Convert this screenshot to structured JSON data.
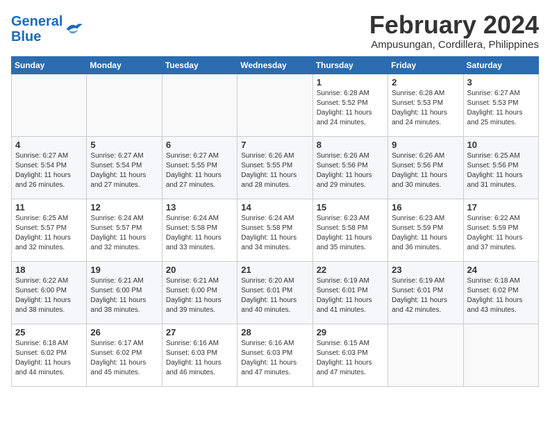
{
  "header": {
    "logo_general": "General",
    "logo_blue": "Blue",
    "month_year": "February 2024",
    "location": "Ampusungan, Cordillera, Philippines"
  },
  "weekdays": [
    "Sunday",
    "Monday",
    "Tuesday",
    "Wednesday",
    "Thursday",
    "Friday",
    "Saturday"
  ],
  "weeks": [
    [
      {
        "day": "",
        "info": ""
      },
      {
        "day": "",
        "info": ""
      },
      {
        "day": "",
        "info": ""
      },
      {
        "day": "",
        "info": ""
      },
      {
        "day": "1",
        "info": "Sunrise: 6:28 AM\nSunset: 5:52 PM\nDaylight: 11 hours\nand 24 minutes."
      },
      {
        "day": "2",
        "info": "Sunrise: 6:28 AM\nSunset: 5:53 PM\nDaylight: 11 hours\nand 24 minutes."
      },
      {
        "day": "3",
        "info": "Sunrise: 6:27 AM\nSunset: 5:53 PM\nDaylight: 11 hours\nand 25 minutes."
      }
    ],
    [
      {
        "day": "4",
        "info": "Sunrise: 6:27 AM\nSunset: 5:54 PM\nDaylight: 11 hours\nand 26 minutes."
      },
      {
        "day": "5",
        "info": "Sunrise: 6:27 AM\nSunset: 5:54 PM\nDaylight: 11 hours\nand 27 minutes."
      },
      {
        "day": "6",
        "info": "Sunrise: 6:27 AM\nSunset: 5:55 PM\nDaylight: 11 hours\nand 27 minutes."
      },
      {
        "day": "7",
        "info": "Sunrise: 6:26 AM\nSunset: 5:55 PM\nDaylight: 11 hours\nand 28 minutes."
      },
      {
        "day": "8",
        "info": "Sunrise: 6:26 AM\nSunset: 5:56 PM\nDaylight: 11 hours\nand 29 minutes."
      },
      {
        "day": "9",
        "info": "Sunrise: 6:26 AM\nSunset: 5:56 PM\nDaylight: 11 hours\nand 30 minutes."
      },
      {
        "day": "10",
        "info": "Sunrise: 6:25 AM\nSunset: 5:56 PM\nDaylight: 11 hours\nand 31 minutes."
      }
    ],
    [
      {
        "day": "11",
        "info": "Sunrise: 6:25 AM\nSunset: 5:57 PM\nDaylight: 11 hours\nand 32 minutes."
      },
      {
        "day": "12",
        "info": "Sunrise: 6:24 AM\nSunset: 5:57 PM\nDaylight: 11 hours\nand 32 minutes."
      },
      {
        "day": "13",
        "info": "Sunrise: 6:24 AM\nSunset: 5:58 PM\nDaylight: 11 hours\nand 33 minutes."
      },
      {
        "day": "14",
        "info": "Sunrise: 6:24 AM\nSunset: 5:58 PM\nDaylight: 11 hours\nand 34 minutes."
      },
      {
        "day": "15",
        "info": "Sunrise: 6:23 AM\nSunset: 5:58 PM\nDaylight: 11 hours\nand 35 minutes."
      },
      {
        "day": "16",
        "info": "Sunrise: 6:23 AM\nSunset: 5:59 PM\nDaylight: 11 hours\nand 36 minutes."
      },
      {
        "day": "17",
        "info": "Sunrise: 6:22 AM\nSunset: 5:59 PM\nDaylight: 11 hours\nand 37 minutes."
      }
    ],
    [
      {
        "day": "18",
        "info": "Sunrise: 6:22 AM\nSunset: 6:00 PM\nDaylight: 11 hours\nand 38 minutes."
      },
      {
        "day": "19",
        "info": "Sunrise: 6:21 AM\nSunset: 6:00 PM\nDaylight: 11 hours\nand 38 minutes."
      },
      {
        "day": "20",
        "info": "Sunrise: 6:21 AM\nSunset: 6:00 PM\nDaylight: 11 hours\nand 39 minutes."
      },
      {
        "day": "21",
        "info": "Sunrise: 6:20 AM\nSunset: 6:01 PM\nDaylight: 11 hours\nand 40 minutes."
      },
      {
        "day": "22",
        "info": "Sunrise: 6:19 AM\nSunset: 6:01 PM\nDaylight: 11 hours\nand 41 minutes."
      },
      {
        "day": "23",
        "info": "Sunrise: 6:19 AM\nSunset: 6:01 PM\nDaylight: 11 hours\nand 42 minutes."
      },
      {
        "day": "24",
        "info": "Sunrise: 6:18 AM\nSunset: 6:02 PM\nDaylight: 11 hours\nand 43 minutes."
      }
    ],
    [
      {
        "day": "25",
        "info": "Sunrise: 6:18 AM\nSunset: 6:02 PM\nDaylight: 11 hours\nand 44 minutes."
      },
      {
        "day": "26",
        "info": "Sunrise: 6:17 AM\nSunset: 6:02 PM\nDaylight: 11 hours\nand 45 minutes."
      },
      {
        "day": "27",
        "info": "Sunrise: 6:16 AM\nSunset: 6:03 PM\nDaylight: 11 hours\nand 46 minutes."
      },
      {
        "day": "28",
        "info": "Sunrise: 6:16 AM\nSunset: 6:03 PM\nDaylight: 11 hours\nand 47 minutes."
      },
      {
        "day": "29",
        "info": "Sunrise: 6:15 AM\nSunset: 6:03 PM\nDaylight: 11 hours\nand 47 minutes."
      },
      {
        "day": "",
        "info": ""
      },
      {
        "day": "",
        "info": ""
      }
    ]
  ]
}
